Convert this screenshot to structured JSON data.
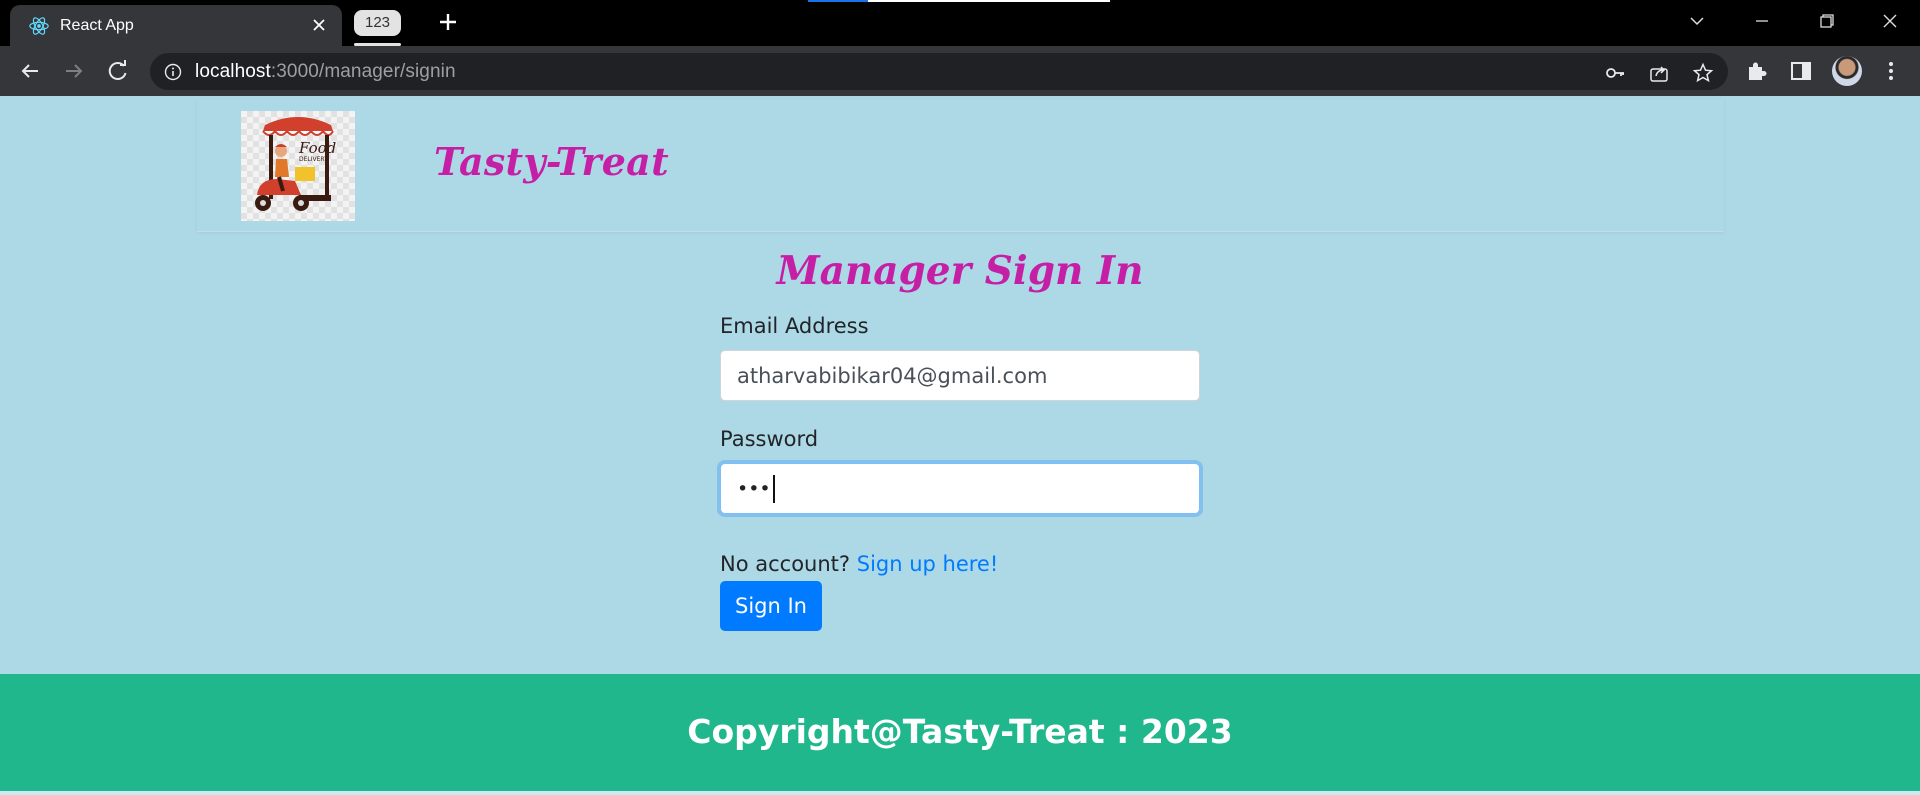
{
  "browser": {
    "tab_title": "React App",
    "tab_counter": "123",
    "url_host": "localhost",
    "url_path": ":3000/manager/signin"
  },
  "header": {
    "brand": "Tasty-Treat",
    "logo_text": "Food",
    "logo_subtext": "DELIVERY"
  },
  "form": {
    "title": "Manager Sign In",
    "email_label": "Email Address",
    "email_value": "atharvabibikar04@gmail.com",
    "password_label": "Password",
    "password_masked": "•••",
    "no_account_text": "No account?",
    "signup_link": "Sign up here!",
    "submit_label": "Sign In"
  },
  "footer": {
    "copyright": "Copyright@Tasty-Treat : 2023"
  },
  "colors": {
    "page_bg": "#add8e6",
    "brand": "#c51fa6",
    "primary": "#007bff",
    "footer_bg": "#20b78c"
  },
  "icons": [
    "react-icon",
    "close-icon",
    "plus-icon",
    "chevron-down-icon",
    "minimize-icon",
    "restore-icon",
    "back-icon",
    "forward-icon",
    "reload-icon",
    "info-icon",
    "key-icon",
    "share-icon",
    "star-icon",
    "extensions-icon",
    "sidepanel-icon",
    "menu-icon"
  ]
}
